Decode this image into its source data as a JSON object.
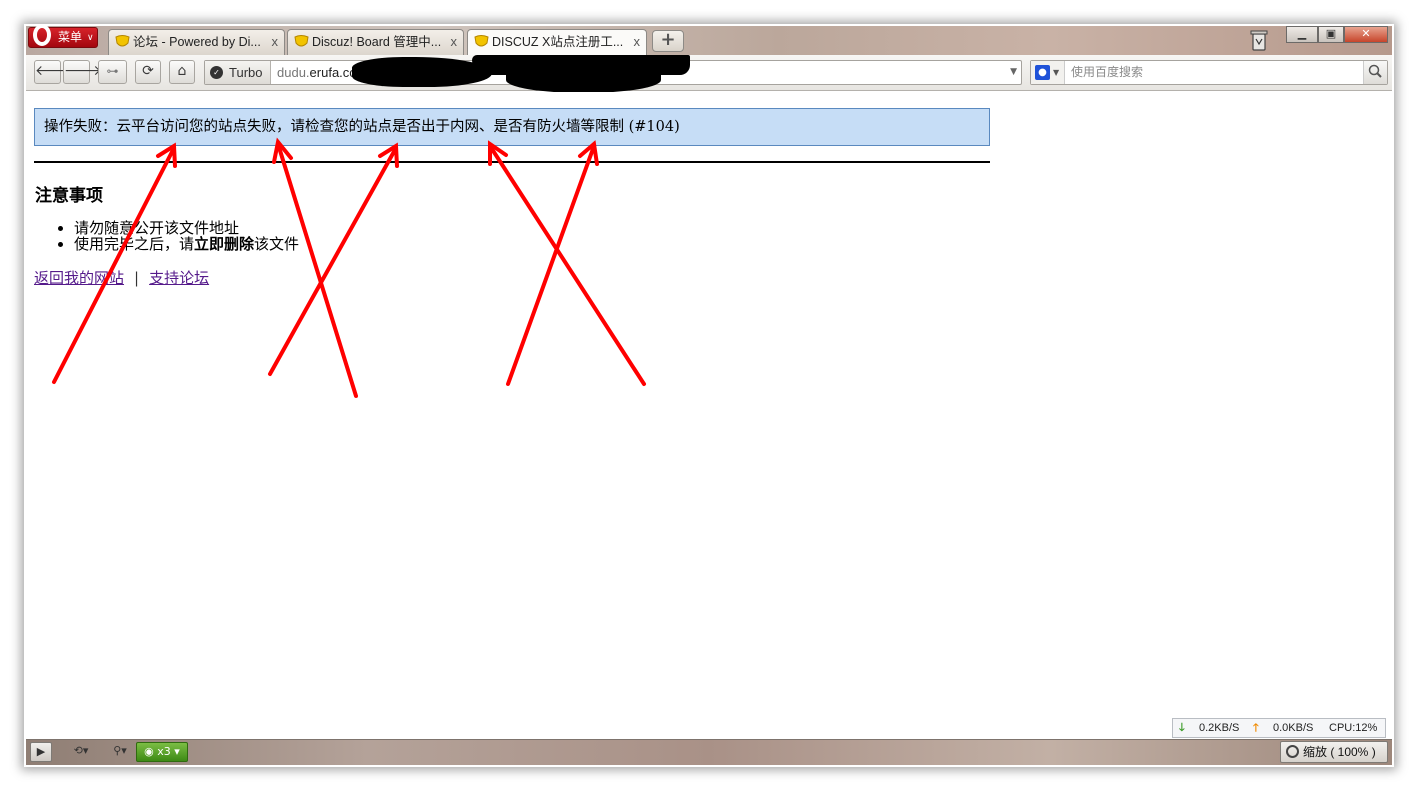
{
  "browser": {
    "menu_label": "菜单",
    "tabs": [
      {
        "title": "论坛 - Powered by Di...",
        "active": false
      },
      {
        "title": "Discuz! Board 管理中...",
        "active": false
      },
      {
        "title": "DISCUZ X站点注册工...",
        "active": true
      }
    ],
    "tab_close_glyph": "x",
    "new_tab_glyph": "+",
    "turbo_label": "Turbo",
    "url_prefix": "dudu.",
    "url_domain": "erufa.co",
    "search_placeholder": "使用百度搜索"
  },
  "page": {
    "error_message": "操作失败：云平台访问您的站点失败，请检查您的站点是否出于内网、是否有防火墙等限制 (#104)",
    "notice_title": "注意事项",
    "notes": [
      {
        "text": "请勿随意公开该文件地址"
      },
      {
        "prefix": "使用完毕之后，请",
        "bold": "立即删除",
        "suffix": "该文件"
      }
    ],
    "links": [
      {
        "label": "返回我的网站"
      },
      {
        "label": "支持论坛"
      }
    ],
    "link_separator": "|"
  },
  "status": {
    "download_speed": "0.2KB/S",
    "upload_speed": "0.0KB/S",
    "cpu": "CPU:12%",
    "zoom": "缩放 ( 100% )",
    "count_badge": "x3"
  },
  "colors": {
    "error_bg": "#c6ddf6",
    "error_border": "#5a89bf",
    "link": "#551a8b",
    "annotation_arrow": "#ff0000"
  }
}
